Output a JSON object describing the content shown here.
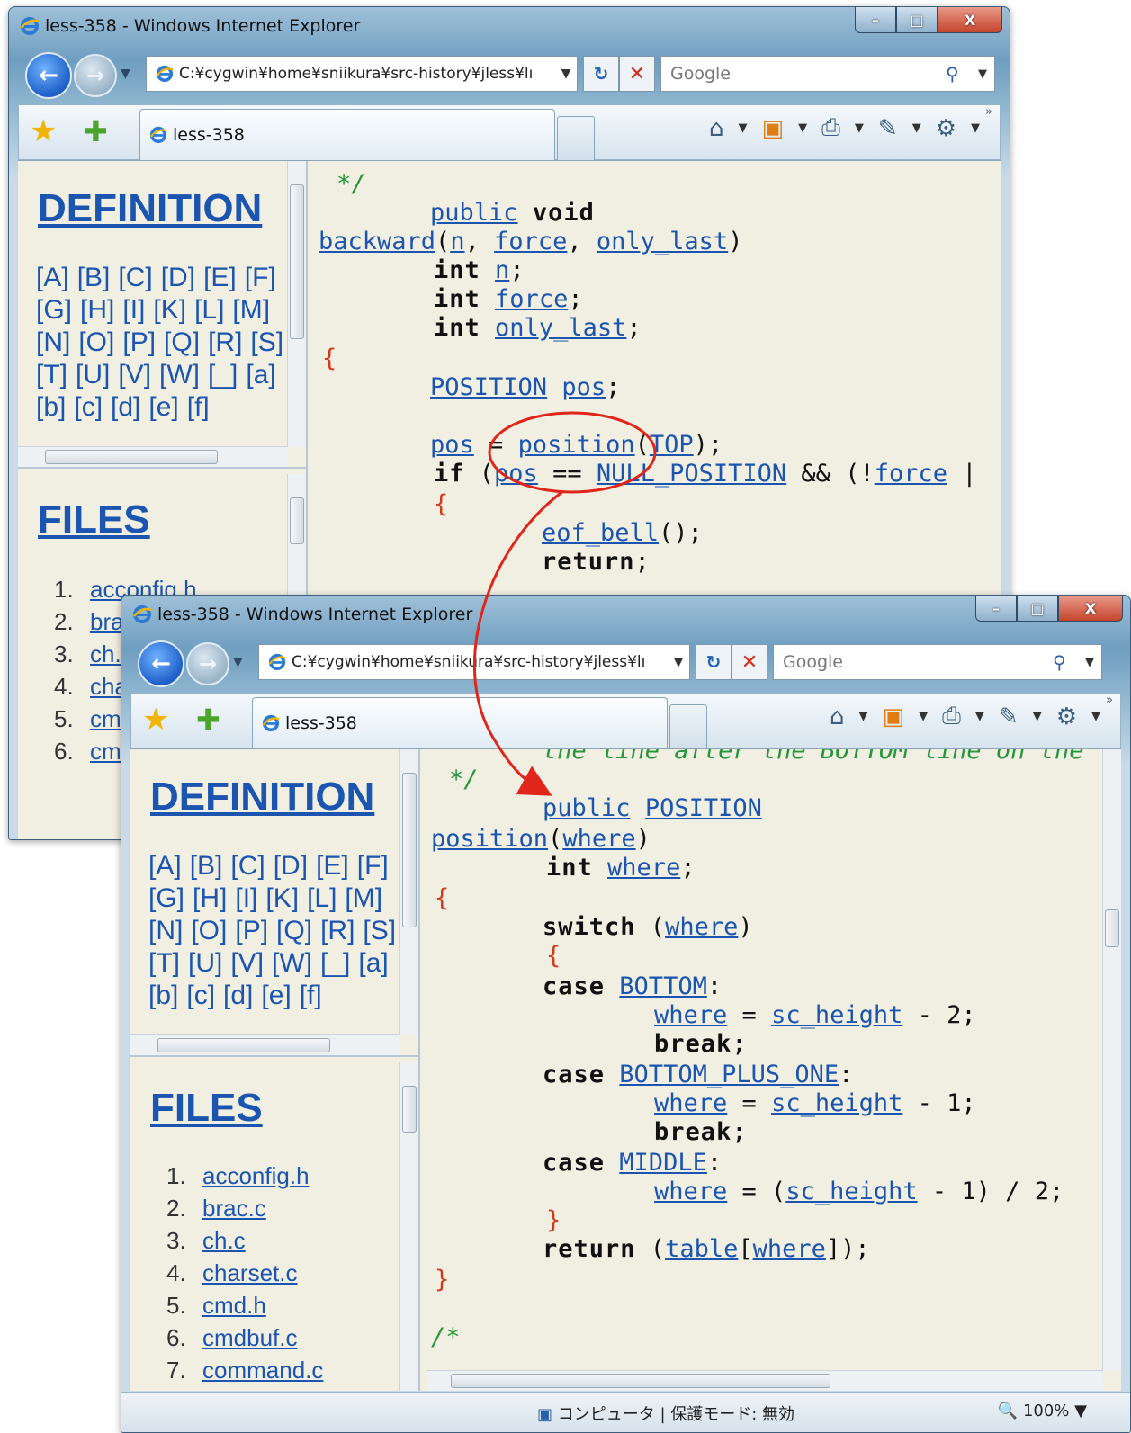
{
  "window": {
    "title": "less-358 - Windows Internet Explorer",
    "address": "C:¥cygwin¥home¥sniikura¥src-history¥jless¥lı",
    "search_placeholder": "Google",
    "tab_label": "less-358"
  },
  "sidebar": {
    "definition_title": "DEFINITION",
    "letters": [
      "[A]",
      "[B]",
      "[C]",
      "[D]",
      "[E]",
      "[F]",
      "[G]",
      "[H]",
      "[I]",
      "[K]",
      "[L]",
      "[M]",
      "[N]",
      "[O]",
      "[P]",
      "[Q]",
      "[R]",
      "[S]",
      "[T]",
      "[U]",
      "[V]",
      "[W]",
      "[_]",
      "[a]",
      "[b]",
      "[c]",
      "[d]",
      "[e]",
      "[f]"
    ],
    "files_title": "FILES",
    "files": [
      {
        "num": "1.",
        "name": "acconfig.h"
      },
      {
        "num": "2.",
        "name": "brac.c"
      },
      {
        "num": "3.",
        "name": "ch.c"
      },
      {
        "num": "4.",
        "name": "charset.c"
      },
      {
        "num": "5.",
        "name": "cmd.h"
      },
      {
        "num": "6.",
        "name": "cmdbuf.c"
      },
      {
        "num": "7.",
        "name": "command.c"
      }
    ]
  },
  "code_top": {
    "l0": "*/",
    "l1a": "public",
    "l1b": "void",
    "l2a": "backward",
    "l2b": "n",
    "l2c": "force",
    "l2d": "only_last",
    "l3a": "int",
    "l3b": "n",
    "l4a": "int",
    "l4b": "force",
    "l5a": "int",
    "l5b": "only_last",
    "l6": "{",
    "l7a": "POSITION",
    "l7b": "pos",
    "l8a": "pos",
    "l8b": "position",
    "l8c": "TOP",
    "l9a": "if",
    "l9b": "pos",
    "l9c": "NULL_POSITION",
    "l9d": "force",
    "l10": "{",
    "l11": "eof_bell",
    "l12": "return"
  },
  "code_bottom": {
    "l0": "the line after the BOTTOM line on the",
    "l1": "*/",
    "l2a": "public",
    "l2b": "POSITION",
    "l3a": "position",
    "l3b": "where",
    "l4a": "int",
    "l4b": "where",
    "l5": "{",
    "l6a": "switch",
    "l6b": "where",
    "l7": "{",
    "l8a": "case",
    "l8b": "BOTTOM",
    "l9a": "where",
    "l9b": "sc_height",
    "l9c": "2",
    "l10": "break",
    "l11a": "case",
    "l11b": "BOTTOM_PLUS_ONE",
    "l12a": "where",
    "l12b": "sc_height",
    "l12c": "1",
    "l13": "break",
    "l14a": "case",
    "l14b": "MIDDLE",
    "l15a": "where",
    "l15b": "sc_height",
    "l15c": "1",
    "l15d": "2",
    "l16": "}",
    "l17a": "return",
    "l17b": "table",
    "l17c": "where",
    "l18": "}",
    "l19": "/*"
  },
  "status": {
    "zone": "コンピュータ | 保護モード: 無効",
    "zoom": "100%"
  },
  "colors": {
    "link": "#1b55b0",
    "brace": "#d23a1e",
    "comment": "#26963b",
    "page_bg": "#f1eee2",
    "annotation": "#e0251b"
  }
}
